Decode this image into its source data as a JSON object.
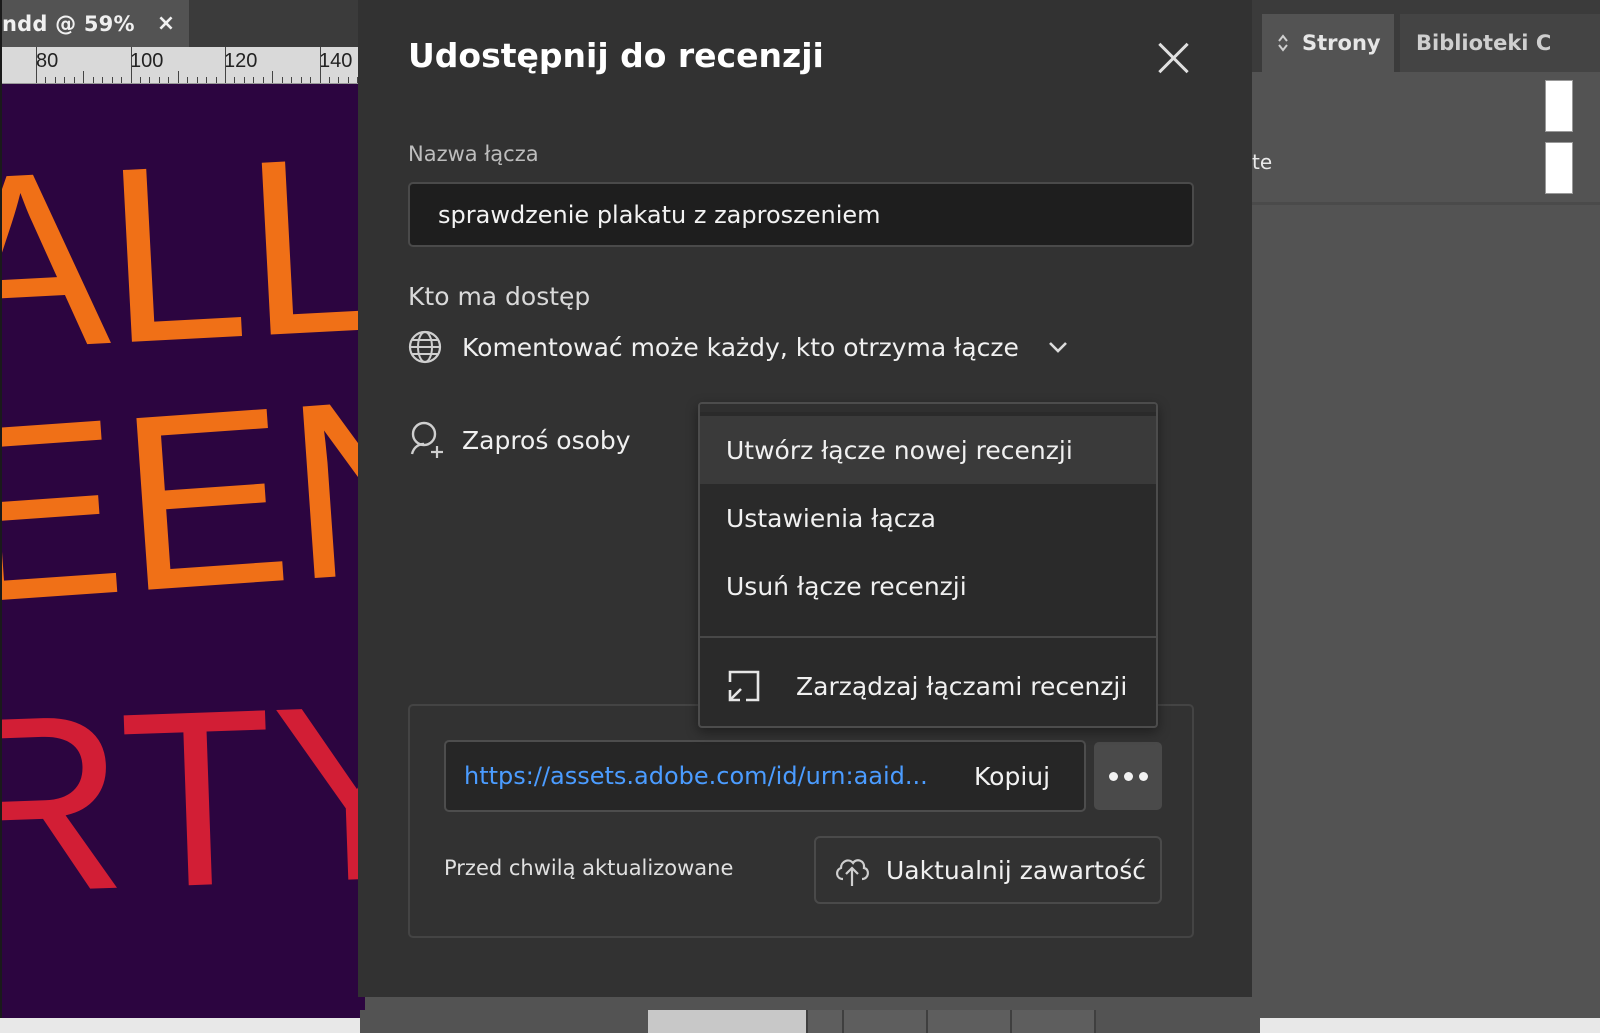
{
  "document_tab": {
    "title": "ndd @ 59%",
    "close_glyph": "×"
  },
  "ruler": {
    "labels": [
      "80",
      "100",
      "120",
      "140"
    ]
  },
  "artwork": {
    "line1": "ALLO",
    "line2": "EEN",
    "line3": "RTY"
  },
  "panel": {
    "tabs": [
      {
        "label": "Strony",
        "active": true
      },
      {
        "label": "Biblioteki C",
        "active": false
      }
    ],
    "fragment": "te"
  },
  "dialog": {
    "title": "Udostępnij do recenzji",
    "link_name": {
      "label": "Nazwa łącza",
      "value": "sprawdzenie plakatu z zaproszeniem"
    },
    "access": {
      "label": "Kto ma dostęp",
      "value": "Komentować może każdy, kto otrzyma łącze"
    },
    "invite": {
      "label": "Zaproś osoby"
    },
    "menu": {
      "items": [
        {
          "label": "Utwórz łącze nowej recenzji",
          "hovered": true
        },
        {
          "label": "Ustawienia łącza"
        },
        {
          "label": "Usuń łącze recenzji"
        },
        {
          "label": "Zarządzaj łączami recenzji"
        }
      ]
    },
    "link": {
      "url": "https://assets.adobe.com/id/urn:aaid...",
      "copy_label": "Kopiuj",
      "updated_text": "Przed chwilą aktualizowane",
      "update_label": "Uaktualnij zawartość"
    }
  },
  "colors": {
    "dialog_bg": "#323232",
    "link_blue": "#4b9cff",
    "art_orange": "#f07017",
    "art_red": "#d21e35",
    "art_bg": "#2c0540"
  },
  "icons": [
    "close-icon",
    "globe-icon",
    "chevron-down-icon",
    "invite-person-icon",
    "more-icon",
    "cloud-upload-icon",
    "manage-links-icon",
    "sort-icon"
  ]
}
